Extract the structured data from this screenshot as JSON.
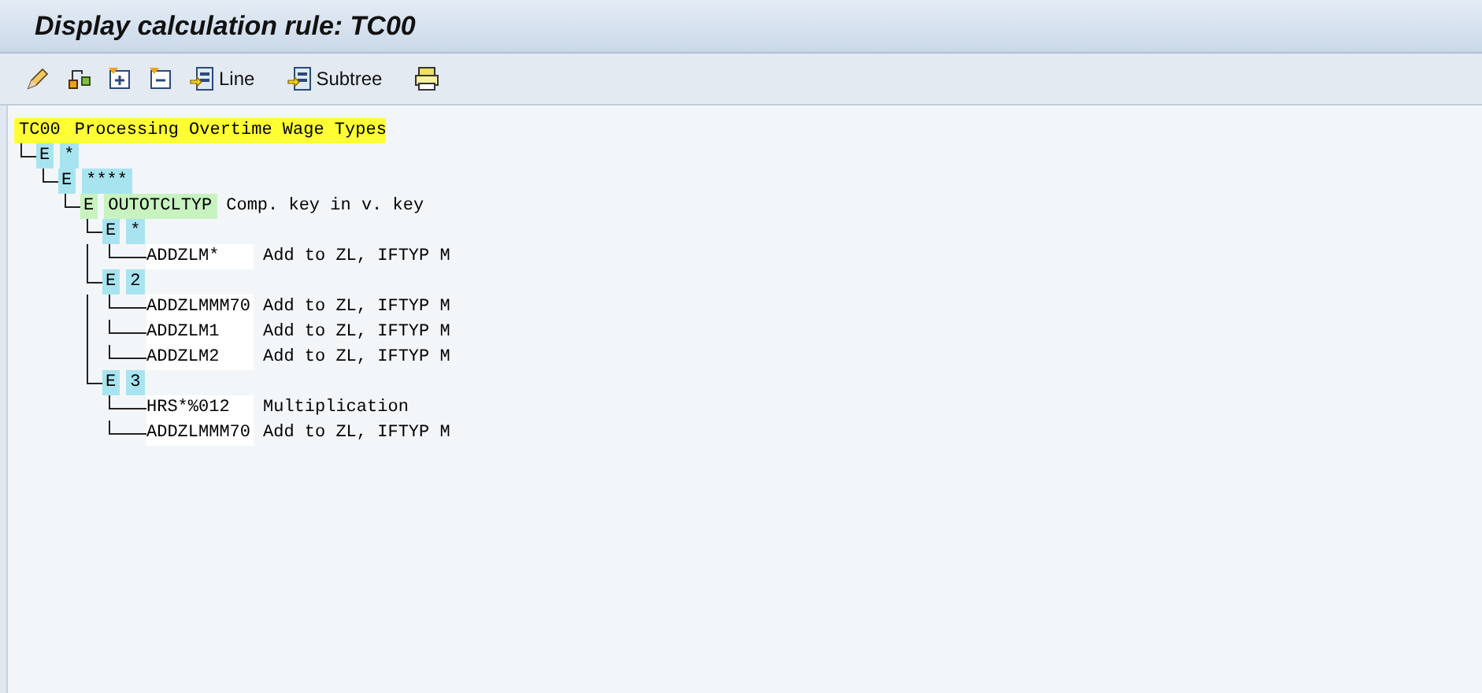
{
  "title": "Display calculation rule: TC00",
  "toolbar": [
    {
      "kind": "icon"
    },
    {
      "kind": "icon"
    },
    {
      "kind": "icon"
    },
    {
      "kind": "icon"
    },
    {
      "kind": "text",
      "label": "Line"
    },
    {
      "kind": "text",
      "label": "Subtree"
    },
    {
      "kind": "icon"
    }
  ],
  "tree": {
    "kind": "root",
    "key": "TC00",
    "text": "Processing Overtime Wage Types",
    "children": [
      {
        "kind": "node",
        "tag": "E",
        "key": "*",
        "color": "#a8e4f0",
        "children": [
          {
            "kind": "node",
            "tag": "E",
            "key": "****",
            "color": "#a8e4f0",
            "children": [
              {
                "kind": "node",
                "tag": "E",
                "key": "OUTOTCLTYP",
                "text": "Comp. key in v. key",
                "color": "#c8f2c0",
                "children": [
                  {
                    "kind": "node",
                    "tag": "E",
                    "key": "*",
                    "color": "#a8e4f0",
                    "children": [
                      {
                        "kind": "leaf",
                        "key": "ADDZLM*",
                        "text": "Add to ZL, IFTYP M"
                      }
                    ]
                  },
                  {
                    "kind": "node",
                    "tag": "E",
                    "key": "2",
                    "color": "#a8e4f0",
                    "children": [
                      {
                        "kind": "leaf",
                        "key": "ADDZLMMM70",
                        "text": "Add to ZL, IFTYP M"
                      },
                      {
                        "kind": "leaf",
                        "key": "ADDZLM1",
                        "text": "Add to ZL, IFTYP M"
                      },
                      {
                        "kind": "leaf",
                        "key": "ADDZLM2",
                        "text": "Add to ZL, IFTYP M"
                      }
                    ]
                  },
                  {
                    "kind": "node",
                    "tag": "E",
                    "key": "3",
                    "color": "#a8e4f0",
                    "children": [
                      {
                        "kind": "leaf",
                        "key": "HRS*%012",
                        "text": "Multiplication"
                      },
                      {
                        "kind": "leaf",
                        "key": "ADDZLMMM70",
                        "text": "Add to ZL, IFTYP M"
                      }
                    ]
                  }
                ]
              }
            ]
          }
        ]
      }
    ]
  }
}
